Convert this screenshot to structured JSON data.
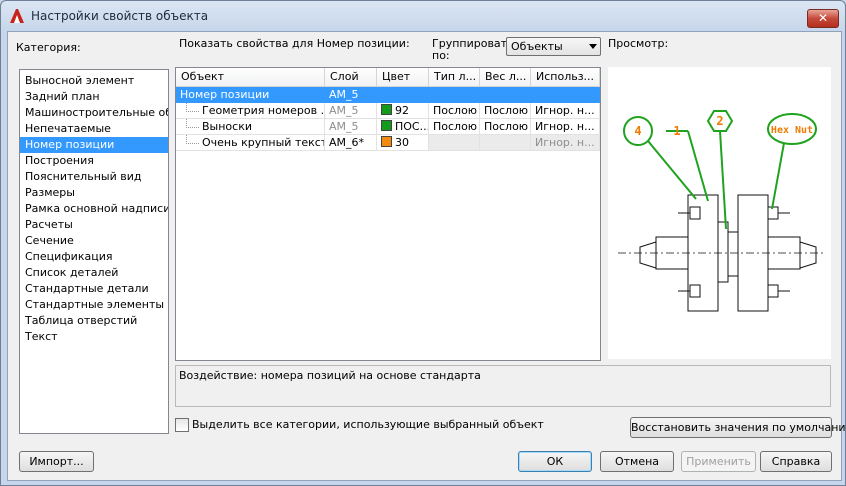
{
  "window": {
    "title": "Настройки свойств объекта",
    "close_glyph": "✕"
  },
  "category": {
    "label": "Категория:",
    "items": [
      "Выносной элемент",
      "Задний план",
      "Машиностроительные обоз",
      "Непечатаемые",
      "Номер позиции",
      "Построения",
      "Пояснительный вид",
      "Размеры",
      "Рамка основной надписи/И",
      "Расчеты",
      "Сечение",
      "Спецификация",
      "Список деталей",
      "Стандартные детали",
      "Стандартные элементы",
      "Таблица отверстий",
      "Текст"
    ],
    "selected_index": 4
  },
  "properties": {
    "show_label": "Показать свойства для Номер позиции:",
    "group_label_line1": "Группировать",
    "group_label_line2": "по:",
    "group_value": "Объекты",
    "columns": [
      "Объект",
      "Слой",
      "Цвет",
      "Тип л...",
      "Вес л...",
      "Использ..."
    ],
    "rows": [
      {
        "object": "Номер позиции",
        "layer": "AM_5",
        "color": "",
        "color_hex": "",
        "linetype": "",
        "lineweight": "",
        "usage": ""
      },
      {
        "object": "Геометрия номеров ...",
        "layer": "AM_5",
        "color": "92",
        "color_hex": "#129a1b",
        "linetype": "Послою",
        "lineweight": "Послою",
        "usage": "Игнор. н..."
      },
      {
        "object": "Выноски",
        "layer": "AM_5",
        "color": "ПОС...",
        "color_hex": "#129a1b",
        "linetype": "Послою",
        "lineweight": "Послою",
        "usage": "Игнор. н..."
      },
      {
        "object": "Очень крупный текст",
        "layer": "AM_6*",
        "color": "30",
        "color_hex": "#f28a10",
        "linetype": "",
        "lineweight": "",
        "usage": "Игнор. н..."
      }
    ]
  },
  "preview": {
    "label": "Просмотр:",
    "balloons": [
      "4",
      "1",
      "2",
      "Hex Nut"
    ],
    "balloon_color": "#1fa31f",
    "text_color": "#f07b00"
  },
  "effect_text": "Воздействие: номера позиций на основе стандарта",
  "select_all_label": "Выделить все категории, использующие выбранный объект",
  "buttons": {
    "restore": "Восстановить значения по умолчанию",
    "import": "Импорт...",
    "ok": "ОК",
    "cancel": "Отмена",
    "apply": "Применить",
    "help": "Справка"
  }
}
